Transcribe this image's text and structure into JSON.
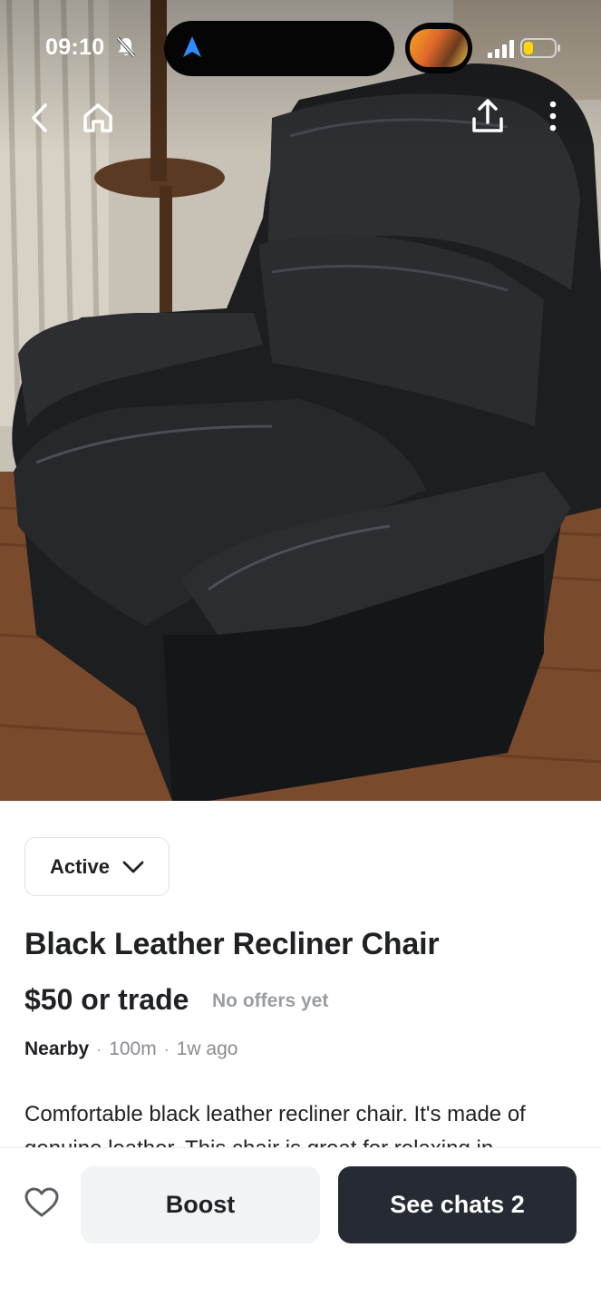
{
  "status_bar": {
    "time": "09:10",
    "icons": [
      "bell-slash-icon",
      "navigation-arrow-icon",
      "now-playing-thumbnail",
      "cellular-signal-icon",
      "battery-icon"
    ]
  },
  "top_nav": {
    "icons": [
      "chevron-left-icon",
      "home-icon",
      "share-icon",
      "more-vertical-icon"
    ]
  },
  "listing": {
    "status": "Active",
    "title": "Black Leather Recliner Chair",
    "price": "$50 or trade",
    "offers": "No offers yet",
    "location": "Nearby",
    "distance": "100m",
    "posted": "1w ago",
    "description": "Comfortable black leather recliner chair. It's made of genuine leather. This chair is great for relaxing in"
  },
  "actions": {
    "boost_label": "Boost",
    "chats_label": "See chats 2"
  },
  "colors": {
    "primary_button": "#262a33",
    "secondary_button": "#f2f3f5",
    "muted_text": "#9a9ca3",
    "text": "#1f2126"
  }
}
